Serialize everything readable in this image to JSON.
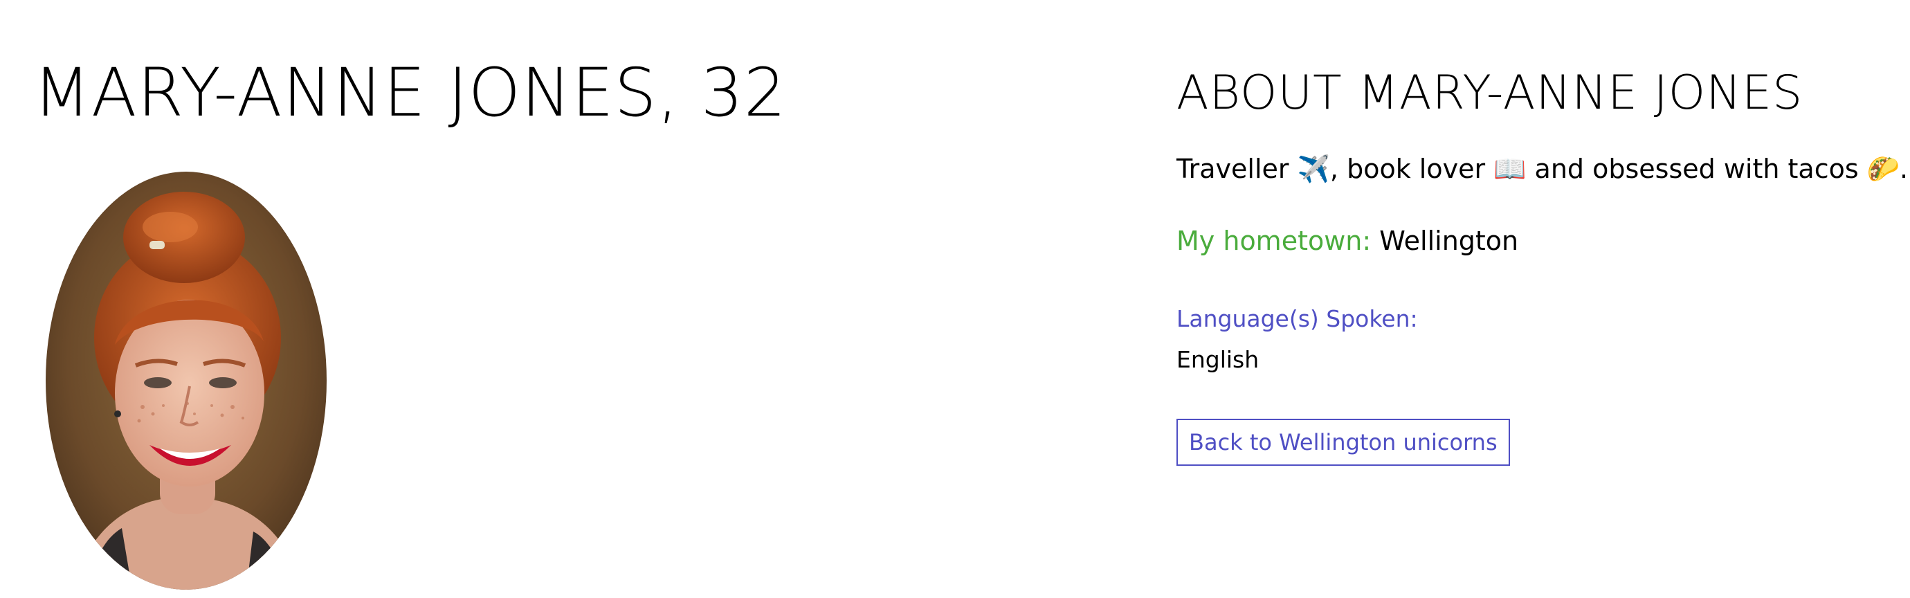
{
  "profile": {
    "name_heading": "MARY-ANNE JONES, 32",
    "photo_description": "Portrait photo of a smiling red-haired woman with a top bun"
  },
  "about": {
    "heading": "ABOUT MARY-ANNE JONES",
    "bio": "Traveller ✈️, book lover 📖 and obsessed with tacos 🌮.",
    "hometown_label": "My hometown:",
    "hometown_value": "Wellington",
    "languages_label": "Language(s) Spoken:",
    "languages_value": "English",
    "back_button_label": "Back to Wellington unicorns"
  },
  "colors": {
    "hometown_label": "#4aac3c",
    "accent": "#4f4fc4"
  }
}
